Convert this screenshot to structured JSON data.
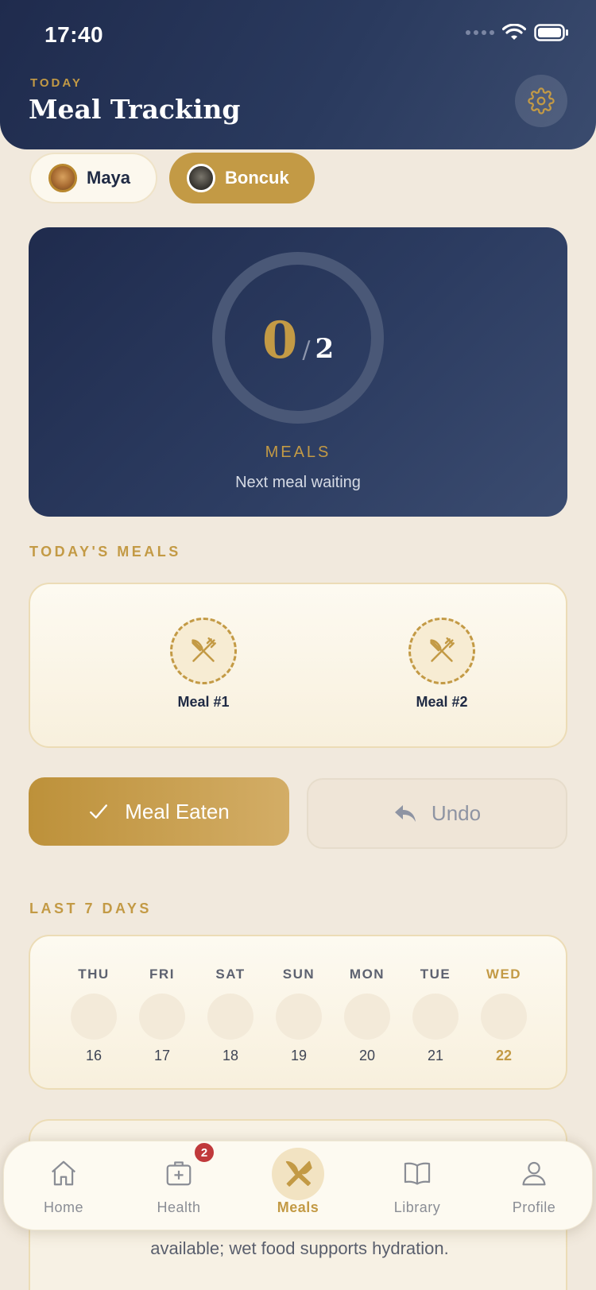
{
  "status_bar": {
    "time": "17:40"
  },
  "header": {
    "eyebrow": "TODAY",
    "title": "Meal Tracking",
    "settings_icon": "gear-icon"
  },
  "pets": [
    {
      "name": "Maya",
      "selected": false
    },
    {
      "name": "Boncuk",
      "selected": true
    }
  ],
  "progress": {
    "eaten": "0",
    "separator": "/",
    "total": "2",
    "fraction": 0,
    "label": "MEALS",
    "status": "Next meal waiting"
  },
  "todays_meals": {
    "title": "TODAY'S MEALS",
    "meals": [
      {
        "name": "Meal #1",
        "icon": "utensils-icon",
        "eaten": false
      },
      {
        "name": "Meal #2",
        "icon": "utensils-icon",
        "eaten": false
      }
    ]
  },
  "actions": {
    "eaten_label": "Meal Eaten",
    "eaten_icon": "checkmark-icon",
    "undo_label": "Undo",
    "undo_icon": "undo-arrow-icon"
  },
  "last_7_days": {
    "title": "LAST 7 DAYS",
    "days": [
      {
        "name": "THU",
        "num": "16",
        "today": false
      },
      {
        "name": "FRI",
        "num": "17",
        "today": false
      },
      {
        "name": "SAT",
        "num": "18",
        "today": false
      },
      {
        "name": "SUN",
        "num": "19",
        "today": false
      },
      {
        "name": "MON",
        "num": "20",
        "today": false
      },
      {
        "name": "TUE",
        "num": "21",
        "today": false
      },
      {
        "name": "WED",
        "num": "22",
        "today": true
      }
    ]
  },
  "tip": {
    "text": "available; wet food supports hydration."
  },
  "tabbar": {
    "tabs": [
      {
        "label": "Home",
        "icon": "home-icon",
        "active": false
      },
      {
        "label": "Health",
        "icon": "medical-kit-icon",
        "active": false,
        "badge": "2"
      },
      {
        "label": "Meals",
        "icon": "utensils-icon",
        "active": true
      },
      {
        "label": "Library",
        "icon": "book-icon",
        "active": false
      },
      {
        "label": "Profile",
        "icon": "person-icon",
        "active": false
      }
    ]
  },
  "colors": {
    "navy": "#1f2b4d",
    "gold": "#c39a45",
    "cream": "#f1e9dd",
    "badge_red": "#c0393b"
  }
}
